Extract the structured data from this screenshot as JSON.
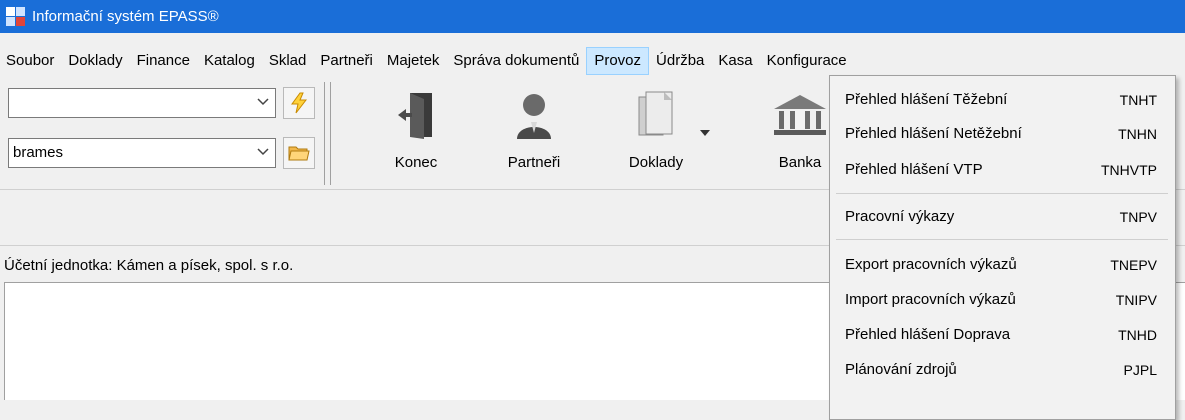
{
  "window": {
    "title": "Informační systém EPASS®"
  },
  "menu": [
    "Soubor",
    "Doklady",
    "Finance",
    "Katalog",
    "Sklad",
    "Partneři",
    "Majetek",
    "Správa dokumentů",
    "Provoz",
    "Údržba",
    "Kasa",
    "Konfigurace"
  ],
  "active_menu": "Provoz",
  "toolbar": {
    "combo1": {
      "value": ""
    },
    "combo2": {
      "value": "brames"
    },
    "buttons": [
      {
        "label": "Konec",
        "icon": "exit-door-icon"
      },
      {
        "label": "Partneři",
        "icon": "person-icon"
      },
      {
        "label": "Doklady",
        "icon": "documents-icon"
      },
      {
        "label": "Banka",
        "icon": "bank-icon"
      }
    ],
    "side_icons": [
      "lightning-icon",
      "folder-icon"
    ]
  },
  "status": {
    "accounting_unit": "Účetní jednotka: Kámen a písek, spol. s r.o."
  },
  "provoz_menu": {
    "groups": [
      [
        {
          "label": "Přehled hlášení Těžební",
          "key": "TNHT"
        },
        {
          "label": "Přehled hlášení Netěžební",
          "key": "TNHN"
        },
        {
          "label": "Přehled hlášení VTP",
          "key": "TNHVTP"
        }
      ],
      [
        {
          "label": "Pracovní výkazy",
          "key": "TNPV"
        }
      ],
      [
        {
          "label": "Export pracovních výkazů",
          "key": "TNEPV"
        },
        {
          "label": "Import pracovních výkazů",
          "key": "TNIPV"
        },
        {
          "label": "Přehled hlášení Doprava",
          "key": "TNHD"
        },
        {
          "label": "Plánování zdrojů",
          "key": "PJPL"
        }
      ]
    ]
  },
  "colors": {
    "titlebar": "#1a6ed8",
    "menu_active": "#cce8ff",
    "menu_active_border": "#99d1ff"
  }
}
